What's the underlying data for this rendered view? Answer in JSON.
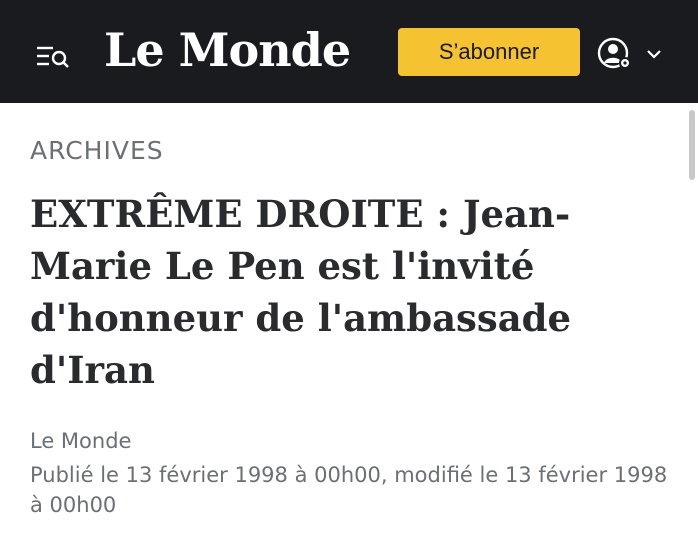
{
  "header": {
    "logo_text": "Le Monde",
    "subscribe_label": "S’abonner",
    "menu_icon": "menu-search-icon",
    "account_icon": "account-settings-icon",
    "account_chevron_icon": "chevron-down-icon"
  },
  "article": {
    "rubric": "ARCHIVES",
    "headline": "EXTRÊME DROITE : Jean-Marie Le Pen est l'invité d'honneur de l'ambassade d'Iran",
    "author": "Le Monde",
    "dates": "Publié le 13 février 1998 à 00h00, modifié le 13 février 1998 à 00h00"
  },
  "colors": {
    "header_bg": "#1a1b1e",
    "subscribe_bg": "#f5c232",
    "headline": "#2a2b2e",
    "meta": "#6b6f76"
  }
}
